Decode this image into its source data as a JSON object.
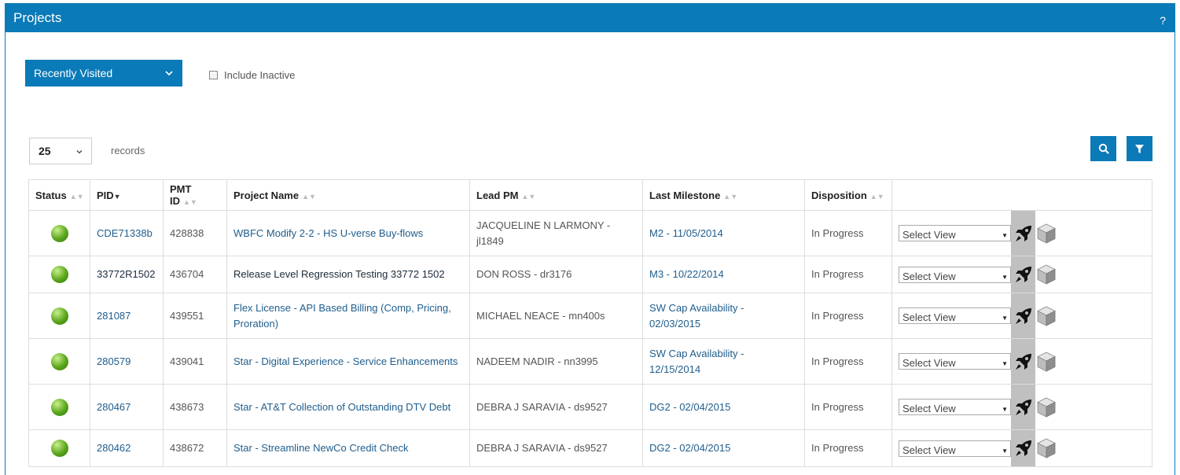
{
  "header": {
    "title": "Projects",
    "help": "?"
  },
  "controls": {
    "view_dropdown": "Recently Visited",
    "include_inactive": "Include Inactive",
    "page_size": "25",
    "records_label": "records"
  },
  "table": {
    "columns": [
      "Status",
      "PID",
      "PMT ID",
      "Project Name",
      "Lead PM",
      "Last Milestone",
      "Disposition",
      ""
    ],
    "rows": [
      {
        "pid": "CDE71338b",
        "pmt": "428838",
        "name": "WBFC Modify 2-2 - HS U-verse Buy-flows",
        "pm": "JACQUELINE N LARMONY - jl1849",
        "milestone": "M2 - 11/05/2014",
        "disposition": "In Progress",
        "view": "Select View"
      },
      {
        "pid": "33772R1502",
        "pmt": "436704",
        "name": "Release Level Regression Testing 33772 1502",
        "pm": "DON ROSS - dr3176",
        "milestone": "M3 - 10/22/2014",
        "disposition": "In Progress",
        "view": "Select View"
      },
      {
        "pid": "281087",
        "pmt": "439551",
        "name": "Flex License - API Based Billing (Comp, Pricing, Proration)",
        "pm": "MICHAEL NEACE - mn400s",
        "milestone": "SW Cap Availability - 02/03/2015",
        "disposition": "In Progress",
        "view": "Select View"
      },
      {
        "pid": "280579",
        "pmt": "439041",
        "name": "Star - Digital Experience - Service Enhancements",
        "pm": "NADEEM NADIR - nn3995",
        "milestone": "SW Cap Availability - 12/15/2014",
        "disposition": "In Progress",
        "view": "Select View"
      },
      {
        "pid": "280467",
        "pmt": "438673",
        "name": "Star - AT&T Collection of Outstanding DTV Debt",
        "pm": "DEBRA J SARAVIA - ds9527",
        "milestone": "DG2 - 02/04/2015",
        "disposition": "In Progress",
        "view": "Select View"
      },
      {
        "pid": "280462",
        "pmt": "438672",
        "name": "Star - Streamline NewCo Credit Check",
        "pm": "DEBRA J SARAVIA - ds9527",
        "milestone": "DG2 - 02/04/2015",
        "disposition": "In Progress",
        "view": "Select View"
      }
    ]
  },
  "colors": {
    "brand": "#0a7ab8",
    "link": "#205e8d",
    "status_ok": "#5aa51c"
  },
  "icons": {
    "rocket": "rocket-icon",
    "cube": "cube-icon",
    "search": "search-icon",
    "filter": "filter-icon"
  }
}
